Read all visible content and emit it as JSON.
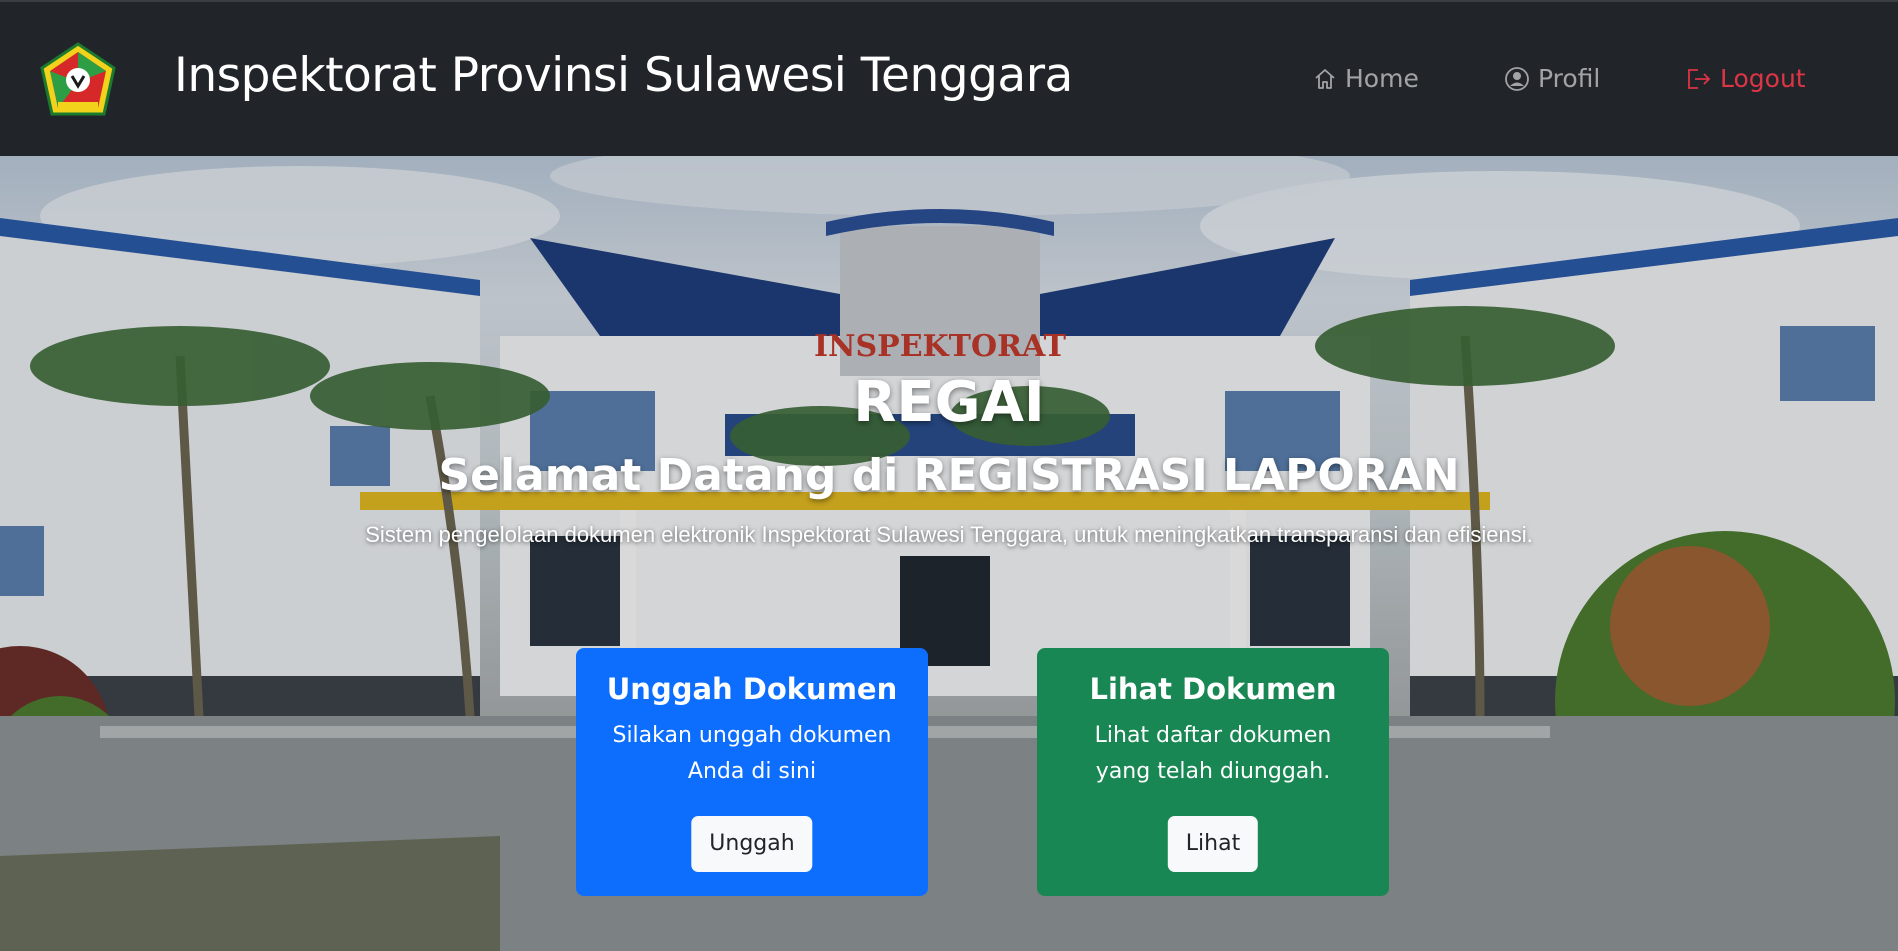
{
  "navbar": {
    "brand": "Inspektorat Provinsi Sulawesi Tenggara",
    "items": [
      {
        "label": "Home",
        "icon": "house-icon"
      },
      {
        "label": "Profil",
        "icon": "person-circle-icon"
      },
      {
        "label": "Logout",
        "icon": "box-arrow-right-icon"
      }
    ]
  },
  "hero": {
    "title": "REGAI",
    "subtitle": "Selamat Datang di REGISTRASI LAPORAN",
    "description": "Sistem pengelolaan dokumen elektronik Inspektorat Sulawesi Tenggara, untuk meningkatkan transparansi dan efisiensi.",
    "building_sign": "INSPEKTORAT"
  },
  "cards": [
    {
      "title": "Unggah Dokumen",
      "text": "Silakan unggah dokumen Anda di sini",
      "button": "Unggah",
      "color": "#0d6efd"
    },
    {
      "title": "Lihat Dokumen",
      "text": "Lihat daftar dokumen yang telah diunggah.",
      "button": "Lihat",
      "color": "#198754"
    }
  ],
  "colors": {
    "navbar_bg": "#212529",
    "logout": "#dc3545",
    "nav_muted": "rgba(255,255,255,0.58)"
  }
}
